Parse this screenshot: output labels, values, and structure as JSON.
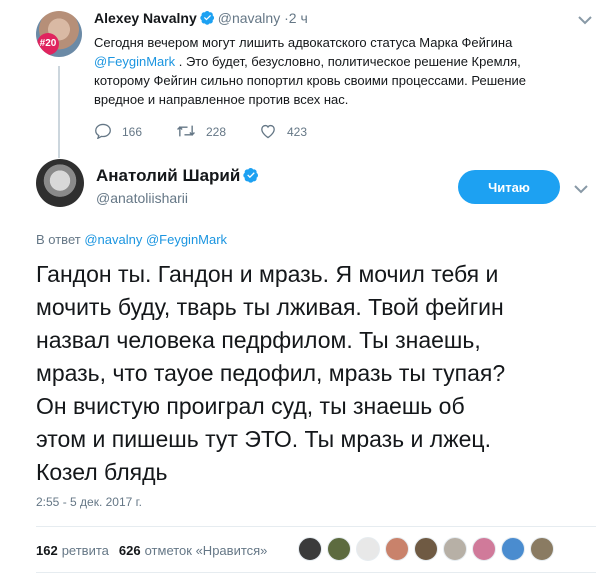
{
  "parent_tweet": {
    "avatar_badge": "#20",
    "name": "Alexey Navalny",
    "handle": "@navalny",
    "dot": "·",
    "time": "2 ч",
    "text_before_mention": "Сегодня вечером могут лишить адвокатского статуса Марка Фейгина ",
    "mention": "@FeyginMark",
    "text_after_mention": " . Это будет, безусловно, политическое решение Кремля, которому Фейгин сильно попортил кровь своими процессами. Решение вредное и направленное против всех нас.",
    "replies": "166",
    "retweets": "228",
    "likes": "423",
    "icons": [
      "verified-icon",
      "chevron-down-icon",
      "reply-icon",
      "retweet-icon",
      "like-icon"
    ]
  },
  "main_tweet": {
    "name": "Анатолий Шарий",
    "handle": "@anatoliisharii",
    "follow_label": "Читаю",
    "reply_prefix": "В ответ ",
    "reply_mention_1": "@navalny",
    "reply_mention_2": "@FeyginMark",
    "text": "Гандон ты. Гандон и мразь. Я мочил тебя и\nмочить буду, тварь ты лживая. Твой фейгин\nназвал человека педрфилом. Ты знаешь,\nмразь, что тауое педофил, мразь ты тупая?\nОн вчистую проиграл суд, ты знаешь об\nэтом и пишешь тут ЭТО. Ты мразь и лжец.\nКозел блядь",
    "timestamp": "2:55 - 5 дек. 2017 г.",
    "retweet_count": "162",
    "retweet_label": "ретвита",
    "like_count": "626",
    "like_label": "отметок «Нравится»"
  },
  "colors": {
    "accent": "#1da1f2",
    "link": "#1b95e0",
    "muted": "#657786",
    "text": "#14171a",
    "divider": "#e6ecf0"
  }
}
